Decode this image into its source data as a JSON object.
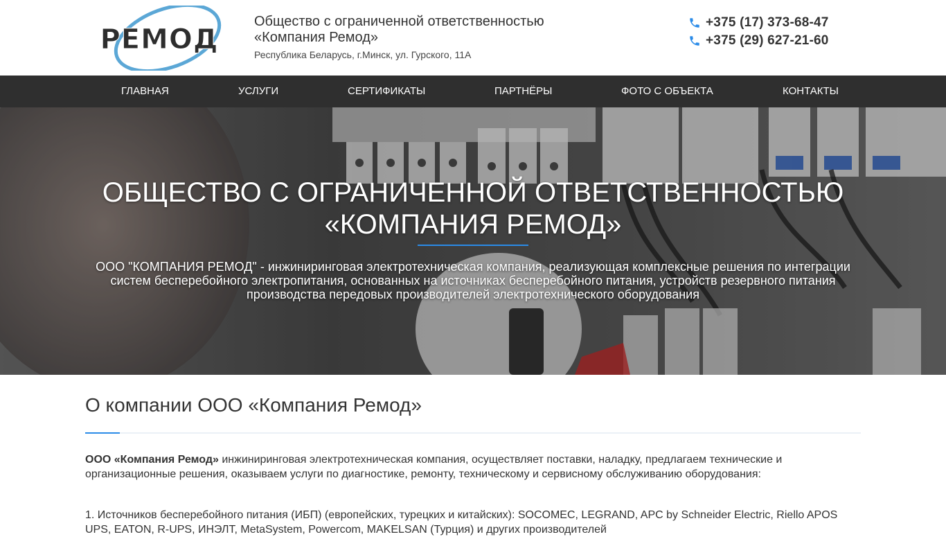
{
  "header": {
    "logo_text": "РЕМОД",
    "company_line1": "Общество с ограниченной ответственностью",
    "company_line2": "«Компания Ремод»",
    "address": "Республика Беларусь, г.Минск, ул. Гурского, 11А",
    "phones": [
      "+375 (17) 373-68-47",
      "+375 (29) 627-21-60"
    ]
  },
  "nav": {
    "items": [
      "Главная",
      "Услуги",
      "Сертификаты",
      "Партнёры",
      "Фото с объекта",
      "Контакты"
    ]
  },
  "hero": {
    "title_line1": "Общество с ограниченной ответственностью",
    "title_line2": "«Компания Ремод»",
    "description": "ООО \"КОМПАНИЯ РЕМОД\" - инжиниринговая электротехническая компания, реализующая комплексные решения по интеграции систем бесперебойного электропитания, основанных на источниках бесперебойного питания, устройств резервного питания производства передовых производителей электротехнического оборудования"
  },
  "about": {
    "title": "О компании ООО «Компания Ремод»",
    "intro_bold": "ООО «Компания Ремод»",
    "intro_rest": " инжиниринговая электротехническая компания, осуществляет поставки, наладку, предлагаем технические и организационные решения, оказываем услуги по диагностике, ремонту, техническому и сервисному обслуживанию оборудования:",
    "item1": "1. Источников бесперебойного питания (ИБП) (европейских, турецких и китайских): SOCOMEC, LEGRAND, APC by Schneider Electric, Riello APOS UPS, EATON, R-UPS, ИНЭЛТ, MetaSystem, Powercom, MAKELSAN (Турция) и других производителей"
  },
  "colors": {
    "accent": "#2a8be8",
    "nav_bg": "#2f2f2f",
    "logo_blue": "#5ba7d6"
  }
}
